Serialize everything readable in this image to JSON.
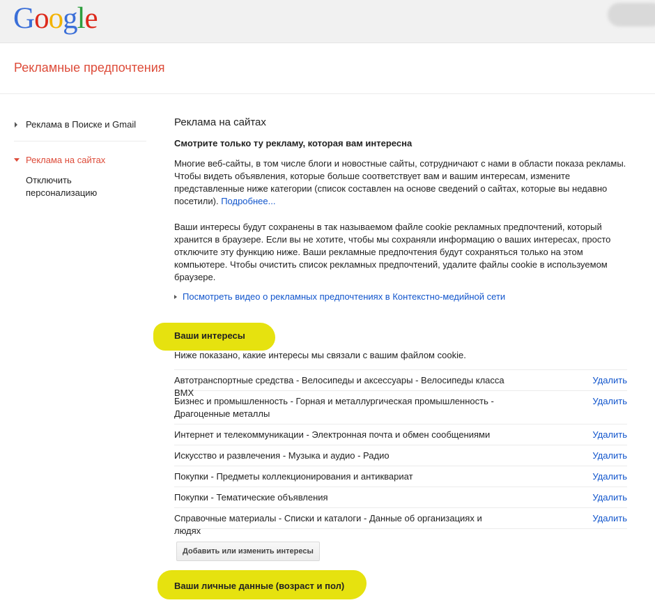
{
  "header": {
    "logo_letters": [
      {
        "ch": "G",
        "color": "#3b6fd8"
      },
      {
        "ch": "o",
        "color": "#dd2a1c"
      },
      {
        "ch": "o",
        "color": "#f3b300"
      },
      {
        "ch": "g",
        "color": "#3b6fd8"
      },
      {
        "ch": "l",
        "color": "#2e9e3e"
      },
      {
        "ch": "e",
        "color": "#dd2a1c"
      }
    ],
    "page_title": "Рекламные предпочтения"
  },
  "sidebar": {
    "items": [
      {
        "label": "Реклама в Поиске и Gmail",
        "active": false
      },
      {
        "label": "Реклама на сайтах",
        "active": true
      },
      {
        "label": "Отключить персонализацию",
        "active": false
      }
    ]
  },
  "main": {
    "section_title": "Реклама на сайтах",
    "heading": "Смотрите только ту рекламу, которая вам интересна",
    "para1": "Многие веб-сайты, в том числе блоги и новостные сайты, сотрудничают с нами в области показа рекламы. Чтобы видеть объявления, которые больше соответствует вам и вашим интересам, измените представленные ниже категории (список составлен на основе сведений о сайтах, которые вы недавно посетили).",
    "more_link": "Подробнее...",
    "para2": "Ваши интересы будут сохранены в так называемом файле cookie рекламных предпочтений, который хранится в браузере. Если вы не хотите, чтобы мы сохраняли информацию о ваших интересах, просто отключите эту функцию ниже. Ваши рекламные предпочтения будут сохраняться только на этом компьютере. Чтобы очистить список рекламных предпочтений, удалите файлы cookie в используемом браузере.",
    "video_link": "Посмотреть видео о рекламных предпочтениях в Контекстно-медийной сети",
    "interests_heading": "Ваши интересы",
    "interests_intro": "Ниже показано, какие интересы мы связали с вашим файлом cookie.",
    "remove_label": "Удалить",
    "interests": [
      "Автотранспортные средства - Велосипеды и аксессуары - Велосипеды класса BMX",
      "Бизнес и промышленность - Горная и металлургическая промышленность - Драгоценные металлы",
      "Интернет и телекоммуникации - Электронная почта и обмен сообщениями",
      "Искусство и развлечения - Музыка и аудио - Радио",
      "Покупки - Предметы коллекционирования и антиквариат",
      "Покупки - Тематические объявления",
      "Справочные материалы - Списки и каталоги - Данные об организациях и людях"
    ],
    "edit_button": "Добавить или изменить интересы",
    "personal_heading": "Ваши личные данные (возраст и пол)"
  },
  "colors": {
    "accent_red": "#dd4b39",
    "link_blue": "#1155cc",
    "highlight_yellow": "#e6e20f"
  }
}
